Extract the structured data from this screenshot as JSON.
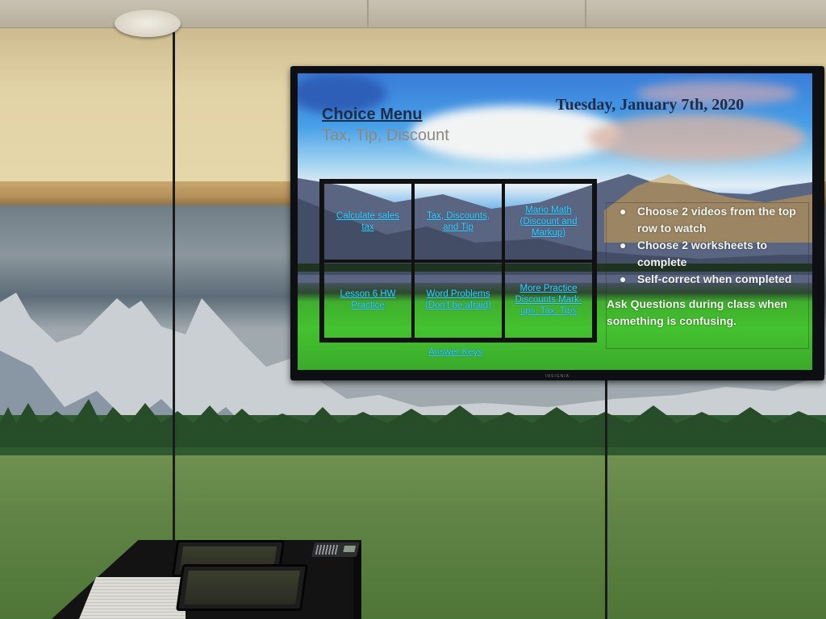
{
  "slide": {
    "title": "Choice Menu",
    "subtitle": "Tax, Tip, Discount",
    "date": "Tuesday, January 7th, 2020",
    "grid": {
      "cells": [
        {
          "label": "Calculate sales tax"
        },
        {
          "label": "Tax, Discounts, and Tip"
        },
        {
          "label": "Mario Math (Discount and Markup)"
        },
        {
          "label": "Lesson 6 HW Practice"
        },
        {
          "label": "Word Problems (Don't be afraid)"
        },
        {
          "label": "More Practice Discounts Mark-ups, Tax, Tips"
        }
      ]
    },
    "answer_keys_label": "Answer Keys",
    "instructions": [
      {
        "bullet": "●",
        "text": "Choose 2 videos from the top row to watch"
      },
      {
        "bullet": "●",
        "text": "Choose 2 worksheets to complete"
      },
      {
        "bullet": "●",
        "text": "Self-correct when completed"
      }
    ],
    "note": "Ask Questions during class when something is confusing.",
    "link_color": "#3fd2ff"
  },
  "tv": {
    "brand": "INSIGNIA"
  }
}
